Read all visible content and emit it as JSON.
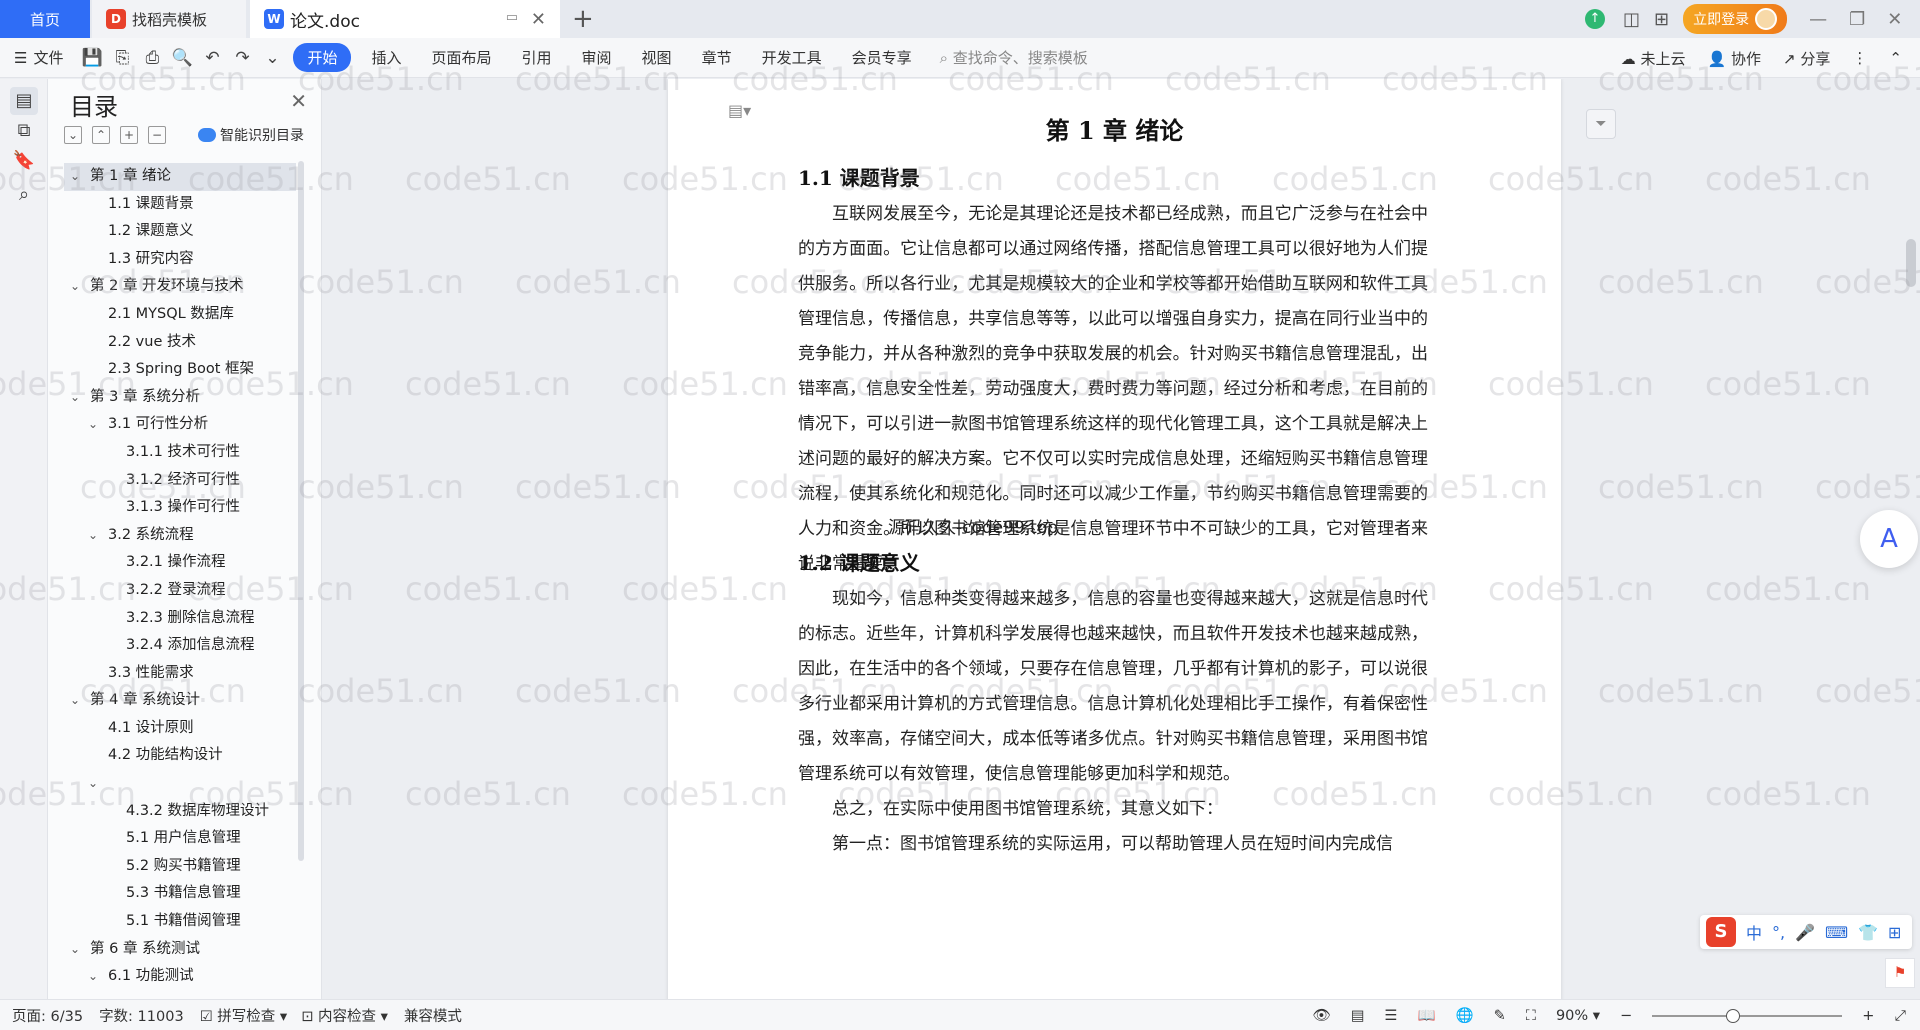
{
  "titlebar": {
    "tab_home": "首页",
    "tab_find": "找稻壳模板",
    "tab_doc": "论文.doc",
    "login": "立即登录"
  },
  "ribbon": {
    "file": "文件",
    "tabs": [
      "开始",
      "插入",
      "页面布局",
      "引用",
      "审阅",
      "视图",
      "章节",
      "开发工具",
      "会员专享"
    ],
    "search": "查找命令、搜索模板",
    "cloud": "未上云",
    "collab": "协作",
    "share": "分享"
  },
  "toc": {
    "title": "目录",
    "smart": "智能识别目录",
    "items": [
      {
        "label": "第 1 章  绪论",
        "level": 0,
        "arrow": true
      },
      {
        "label": "1.1  课题背景",
        "level": 1,
        "arrow": false
      },
      {
        "label": "1.2  课题意义",
        "level": 1,
        "arrow": false
      },
      {
        "label": "1.3  研究内容",
        "level": 1,
        "arrow": false
      },
      {
        "label": "第 2 章  开发环境与技术",
        "level": 0,
        "arrow": true
      },
      {
        "label": "2.1  MYSQL 数据库",
        "level": 1,
        "arrow": false
      },
      {
        "label": "2.2  vue 技术",
        "level": 1,
        "arrow": false
      },
      {
        "label": "2.3  Spring Boot 框架",
        "level": 1,
        "arrow": false
      },
      {
        "label": "第 3 章  系统分析",
        "level": 0,
        "arrow": true
      },
      {
        "label": "3.1  可行性分析",
        "level": 1,
        "arrow": true
      },
      {
        "label": "3.1.1  技术可行性",
        "level": 2,
        "arrow": false
      },
      {
        "label": "3.1.2  经济可行性",
        "level": 2,
        "arrow": false
      },
      {
        "label": "3.1.3  操作可行性",
        "level": 2,
        "arrow": false
      },
      {
        "label": "3.2  系统流程",
        "level": 1,
        "arrow": true
      },
      {
        "label": "3.2.1  操作流程",
        "level": 2,
        "arrow": false
      },
      {
        "label": "3.2.2  登录流程",
        "level": 2,
        "arrow": false
      },
      {
        "label": "3.2.3  删除信息流程",
        "level": 2,
        "arrow": false
      },
      {
        "label": "3.2.4  添加信息流程",
        "level": 2,
        "arrow": false
      },
      {
        "label": "3.3  性能需求",
        "level": 1,
        "arrow": false
      },
      {
        "label": "第 4 章  系统设计",
        "level": 0,
        "arrow": true
      },
      {
        "label": "4.1  设计原则",
        "level": 1,
        "arrow": false
      },
      {
        "label": "4.2  功能结构设计",
        "level": 1,
        "arrow": false
      },
      {
        "label": "",
        "level": 1,
        "arrow": true
      },
      {
        "label": "4.3.2  数据库物理设计",
        "level": 2,
        "arrow": false
      },
      {
        "label": "5.1 用户信息管理",
        "level": 2,
        "arrow": false
      },
      {
        "label": "5.2  购买书籍管理",
        "level": 2,
        "arrow": false
      },
      {
        "label": "5.3 书籍信息管理",
        "level": 2,
        "arrow": false
      },
      {
        "label": "5.1 书籍借阅管理",
        "level": 2,
        "arrow": false
      },
      {
        "label": "第 6 章  系统测试",
        "level": 0,
        "arrow": true
      },
      {
        "label": "6.1  功能测试",
        "level": 1,
        "arrow": true
      }
    ]
  },
  "document": {
    "chapter_title": "第 1 章  绪论",
    "sec1_title": "1.1  课题背景",
    "sec1_text": "互联网发展至今，无论是其理论还是技术都已经成熟，而且它广泛参与在社会中的方方面面。它让信息都可以通过网络传播，搭配信息管理工具可以很好地为人们提供服务。所以各行业，尤其是规模较大的企业和学校等都开始借助互联网和软件工具管理信息，传播信息，共享信息等等，以此可以增强自身实力，提高在同行业当中的竞争能力，并从各种激烈的竞争中获取发展的机会。针对购买书籍信息管理混乱，出错率高，信息安全性差，劳动强度大，费时费力等问题，经过分析和考虑，在目前的情况下，可以引进一款图书馆管理系统这样的现代化管理工具，这个工具就是解决上述问题的最好的解决方案。它不仅可以实时完成信息处理，还缩短购买书籍信息管理流程，使其系统化和规范化。同时还可以减少工作量，节约购买书籍信息管理需要的人力和资金。所以图书馆管理系统是信息管理环节中不可缺少的工具，它对管理者来说非常重要。",
    "overlay": "源码久久-code99.top",
    "sec2_title": "1.2  课题意义",
    "sec2_text": "现如今，信息种类变得越来越多，信息的容量也变得越来越大，这就是信息时代的标志。近些年，计算机科学发展得也越来越快，而且软件开发技术也越来越成熟，因此，在生活中的各个领域，只要存在信息管理，几乎都有计算机的影子，可以说很多行业都采用计算机的方式管理信息。信息计算机化处理相比手工操作，有着保密性强，效率高，存储空间大，成本低等诸多优点。针对购买书籍信息管理，采用图书馆管理系统可以有效管理，使信息管理能够更加科学和规范。",
    "sec2_text2": "总之，在实际中使用图书馆管理系统，其意义如下：",
    "sec2_text3": "第一点：图书馆管理系统的实际运用，可以帮助管理人员在短时间内完成信"
  },
  "statusbar": {
    "page": "页面: 6/35",
    "words": "字数: 11003",
    "spell": "拼写检查",
    "content_check": "内容检查",
    "compat": "兼容模式",
    "zoom": "90%"
  },
  "ime": {
    "lang": "中"
  },
  "watermark": "code51.cn"
}
